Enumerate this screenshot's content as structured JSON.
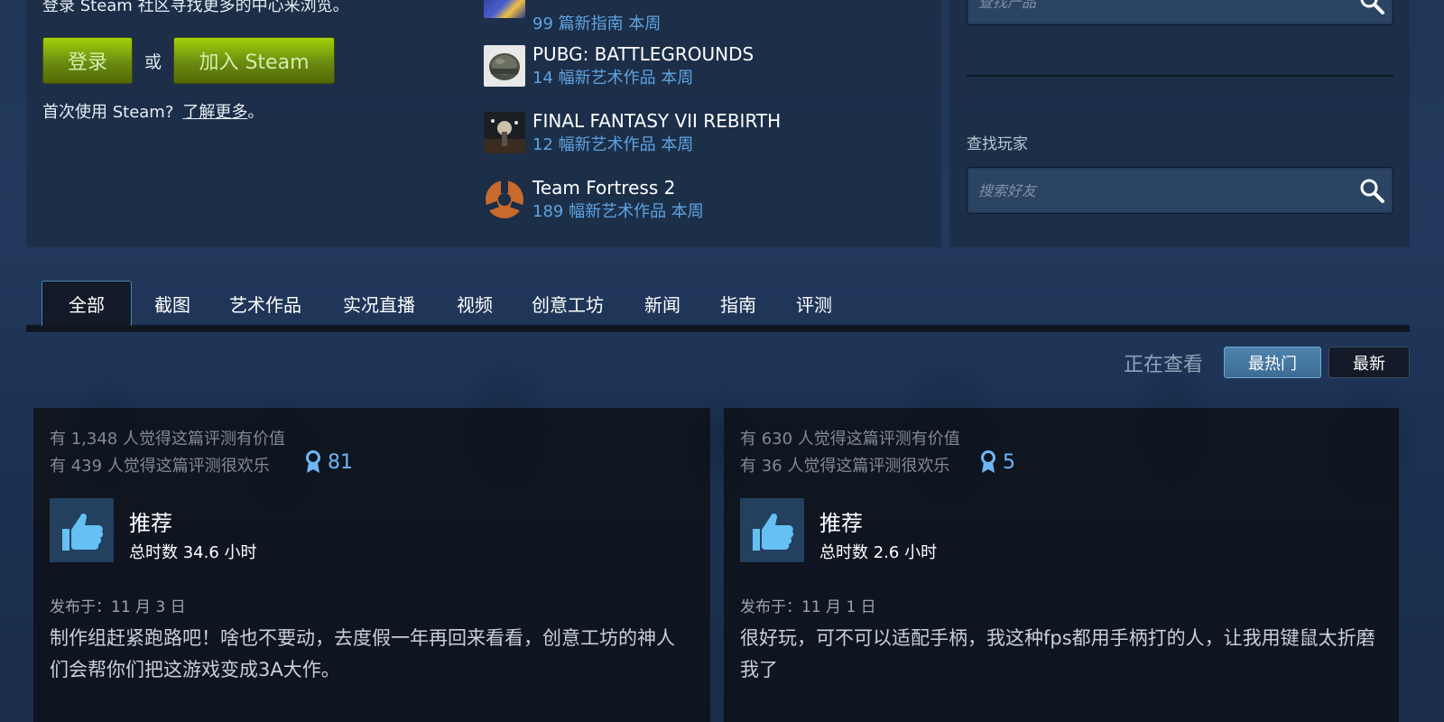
{
  "login": {
    "prompt": "登录 Steam 社区寻找更多的中心来浏览。",
    "login_label": "登录",
    "or_label": "或",
    "join_label": "加入 Steam",
    "first_time_label": "首次使用 Steam?",
    "learn_more_label": "了解更多",
    "learn_more_suffix": "。"
  },
  "trending": [
    {
      "name": "",
      "subtitle": "99 篇新指南 本周",
      "icon": "game-thumb-yellow"
    },
    {
      "name": "PUBG: BATTLEGROUNDS",
      "subtitle": "14 幅新艺术作品 本周",
      "icon": "pubg-helmet-thumb"
    },
    {
      "name": "FINAL FANTASY VII REBIRTH",
      "subtitle": "12 幅新艺术作品 本周",
      "icon": "ff7-thumb"
    },
    {
      "name": "Team Fortress 2",
      "subtitle": "189 幅新艺术作品 本周",
      "icon": "tf2-logo-thumb"
    }
  ],
  "search": {
    "product_placeholder": "查找产品",
    "find_players_label": "查找玩家",
    "friends_placeholder": "搜索好友"
  },
  "tabs": [
    {
      "label": "全部",
      "active": true
    },
    {
      "label": "截图"
    },
    {
      "label": "艺术作品"
    },
    {
      "label": "实况直播"
    },
    {
      "label": "视频"
    },
    {
      "label": "创意工坊"
    },
    {
      "label": "新闻"
    },
    {
      "label": "指南"
    },
    {
      "label": "评测"
    }
  ],
  "sort": {
    "viewing_label": "正在查看",
    "popular_label": "最热门",
    "newest_label": "最新"
  },
  "reviews": [
    {
      "helpful": "有 1,348 人觉得这篇评测有价值",
      "funny": "有 439 人觉得这篇评测很欢乐",
      "awards": "81",
      "verdict": "推荐",
      "hours": "总时数 34.6 小时",
      "posted": "发布于：11 月 3 日",
      "body": "制作组赶紧跑路吧！啥也不要动，去度假一年再回来看看，创意工坊的神人们会帮你们把这游戏变成3A大作。"
    },
    {
      "helpful": "有 630 人觉得这篇评测有价值",
      "funny": "有 36 人觉得这篇评测很欢乐",
      "awards": "5",
      "verdict": "推荐",
      "hours": "总时数 2.6 小时",
      "posted": "发布于：11 月 1 日",
      "body": "很好玩，可不可以适配手柄，我这种fps都用手柄打的人，让我用键鼠太折磨我了"
    }
  ],
  "colors": {
    "accent_blue": "#5fa3e0",
    "green_button": "#a4d007",
    "award_blue": "#6fb6f5"
  }
}
